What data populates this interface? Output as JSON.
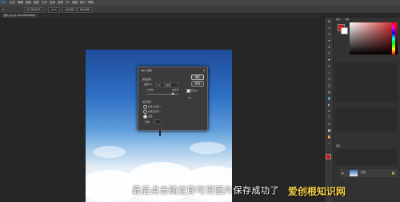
{
  "menubar": {
    "items": [
      "Ps",
      "文件",
      "编辑",
      "图像",
      "图层",
      "文字",
      "选择",
      "滤镜",
      "3D",
      "视图",
      "窗口",
      "帮助"
    ]
  },
  "options_bar": {
    "pills": [
      "显示变换控件",
      "100%",
      "适合屏幕",
      "填充屏幕"
    ]
  },
  "document_tab": {
    "label": "图片.jpg @ 100%(RGB/8#)"
  },
  "dialog": {
    "title": "JPEG 选项",
    "close": "×",
    "ok_label": "确定",
    "cancel_label": "取消",
    "preview_label": "预览(P)",
    "image_options_label": "图像选项",
    "quality_label": "品质(Q):",
    "quality_value": "10",
    "quality_preset": "最佳",
    "small_file_label": "小文件",
    "large_file_label": "大文件",
    "format_options_label": "格式选项",
    "format_baseline_std": "基线(\"标准\")",
    "format_baseline_opt": "基线已优化",
    "format_progressive": "连续",
    "scan_label": "扫描:",
    "scan_value": "3",
    "file_size": "0K"
  },
  "panels": {
    "color_tab": "颜色",
    "swatches_tab": "色板",
    "layers_tab": "图层",
    "layer_name": "背景",
    "colors": {
      "fg": "#d41414",
      "bg": "#ffffff"
    }
  },
  "tools": [
    "move-icon",
    "marquee-icon",
    "lasso-icon",
    "wand-icon",
    "crop-icon",
    "eyedropper-icon",
    "heal-icon",
    "brush-icon",
    "stamp-icon",
    "history-icon",
    "eraser-icon",
    "gradient-icon",
    "blur-icon",
    "dodge-icon",
    "pen-icon",
    "type-icon",
    "path-icon",
    "shape-icon",
    "hand-icon",
    "zoom-icon"
  ],
  "subtitle": "最后点击确定即可将图片保存成功了",
  "watermark": "爱创根知识网"
}
